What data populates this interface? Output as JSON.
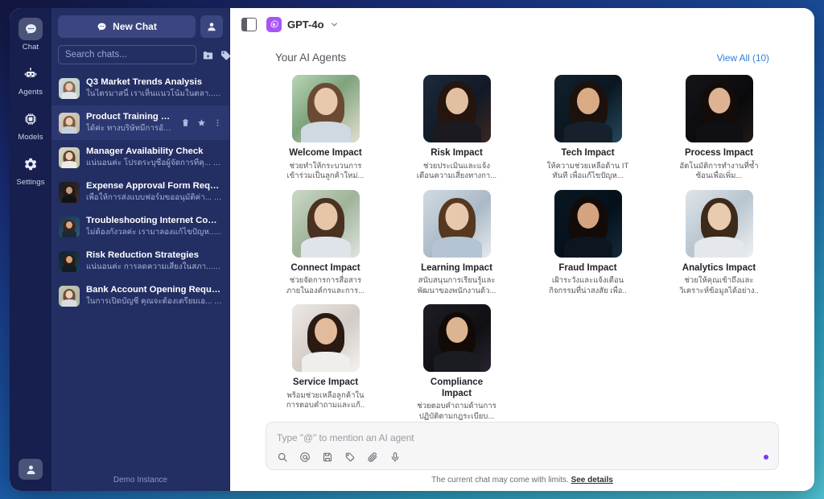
{
  "window": {
    "background_gradient": [
      "#12173f",
      "#1a2d7a",
      "#1a5aa8",
      "#2d9fc0",
      "#4fc3d4"
    ]
  },
  "rail": {
    "items": [
      {
        "label": "Chat",
        "icon": "chat-bubble-icon",
        "active": true
      },
      {
        "label": "Agents",
        "icon": "robot-icon",
        "active": false
      },
      {
        "label": "Models",
        "icon": "chip-icon",
        "active": false
      },
      {
        "label": "Settings",
        "icon": "gear-icon",
        "active": false
      }
    ],
    "bottom_icon": "user-avatar-icon"
  },
  "sidebar": {
    "new_chat_label": "New Chat",
    "new_chat_icon": "chat-bubble-icon",
    "profile_icon": "user-avatar-icon",
    "search_placeholder": "Search chats...",
    "search_value": "",
    "toolbar_icons": [
      "new-folder-icon",
      "tag-icon",
      "multi-select-icon"
    ],
    "footer_label": "Demo Instance",
    "hover_actions": [
      "delete-icon",
      "star-icon",
      "more-options-icon"
    ],
    "chats": [
      {
        "title": "Q3 Market Trends Analysis",
        "preview": "ในไตรมาสนี้ เราเห็นแนวโน้มในตลา...",
        "time": "17h",
        "hovered": false,
        "c1": "#cfd6dc",
        "c2": "#8a6a54",
        "c3": "#b8d0c2"
      },
      {
        "title": "Product Training Upda...",
        "preview": "ได้ค่ะ ทางบริษัทมีการอัป...",
        "time": "17h",
        "hovered": true,
        "c1": "#d8cfc6",
        "c2": "#7c5a42",
        "c3": "#c2b49e"
      },
      {
        "title": "Manager Availability Check",
        "preview": "แน่นอนค่ะ โปรดระบุชื่อผู้จัดการที่คุ...",
        "time": "17h",
        "hovered": false,
        "c1": "#dcd6c8",
        "c2": "#5d4433",
        "c3": "#b6bd9c"
      },
      {
        "title": "Expense Approval Form Request",
        "preview": "เพื่อให้การส่งแบบฟอร์มขออนุมัติค่า...",
        "time": "17h",
        "hovered": false,
        "c1": "#1a1a1e",
        "c2": "#2a2024",
        "c3": "#3a3036"
      },
      {
        "title": "Troubleshooting Internet Conn...",
        "preview": "ไม่ต้องกังวลค่ะ เรามาลองแก้ไขปัญห...",
        "time": "17h",
        "hovered": false,
        "c1": "#20344d",
        "c2": "#4a3228",
        "c3": "#2d5a7a"
      },
      {
        "title": "Risk Reduction Strategies",
        "preview": "แน่นอนค่ะ การลดความเสี่ยงในสภา...",
        "time": "17h",
        "hovered": false,
        "c1": "#13212e",
        "c2": "#33221c",
        "c3": "#1d4054"
      },
      {
        "title": "Bank Account Opening Require...",
        "preview": "ในการเปิดบัญชี คุณจะต้องเตรียมเอ...",
        "time": "17h",
        "hovered": false,
        "c1": "#cbc4b4",
        "c2": "#6b4d38",
        "c3": "#a8b6a0"
      }
    ]
  },
  "header": {
    "panel_toggle_icon": "panel-toggle-icon",
    "model_logo_icon": "openai-logo-icon",
    "model_name": "GPT-4o",
    "chevron_icon": "chevron-down-icon"
  },
  "agents_section": {
    "title": "Your AI Agents",
    "view_all_label": "View All (10)",
    "agents": [
      {
        "name": "Welcome Impact",
        "desc": "ช่วยทำให้กระบวนการ เข้าร่วมเป็นลูกค้าใหม่...",
        "bg": "#9dbfa0",
        "skin": "#e8c9ae",
        "hair": "#6b4a33",
        "cloth": "#cfd9e2"
      },
      {
        "name": "Risk Impact",
        "desc": "ช่วยประเมินและแจ้ง เตือนความเสี่ยงทางกา...",
        "bg": "#16202e",
        "skin": "#e3bfa2",
        "hair": "#24150f",
        "cloth": "#1a1a20"
      },
      {
        "name": "Tech Impact",
        "desc": "ให้ความช่วยเหลือด้าน IT ทันที เพื่อแก้ไขปัญห...",
        "bg": "#0e1a26",
        "skin": "#d9ab85",
        "hair": "#1c110c",
        "cloth": "#16212c"
      },
      {
        "name": "Process Impact",
        "desc": "อัตโนมัติการทำงานที่ซ้ำ ซ้อนเพื่อเพิ่ม...",
        "bg": "#0c0c0e",
        "skin": "#ddb391",
        "hair": "#140c09",
        "cloth": "#101014"
      },
      {
        "name": "Connect Impact",
        "desc": "ช่วยจัดการการสื่อสาร ภายในองค์กรและการ...",
        "bg": "#b9c8b4",
        "skin": "#e6c5a8",
        "hair": "#4a3121",
        "cloth": "#dfe4ea"
      },
      {
        "name": "Learning Impact",
        "desc": "สนับสนุนการเรียนรู้และ พัฒนาของพนักงานด้ว...",
        "bg": "#c3cdd6",
        "skin": "#e8c8ad",
        "hair": "#55381f",
        "cloth": "#b4c4d4"
      },
      {
        "name": "Fraud Impact",
        "desc": "เฝ้าระวังและแจ้งเตือน กิจกรรมที่น่าสงสัย เพื่อ..",
        "bg": "#07121c",
        "skin": "#d3a47f",
        "hair": "#130b08",
        "cloth": "#0c1620"
      },
      {
        "name": "Analytics Impact",
        "desc": "ช่วยให้คุณเข้าถึงและ วิเคราะห์ข้อมูลได้อย่าง..",
        "bg": "#cfd8de",
        "skin": "#e9cbb0",
        "hair": "#3e2a1a",
        "cloth": "#e4e8ed"
      },
      {
        "name": "Service Impact",
        "desc": "พร้อมช่วยเหลือลูกค้าใน การตอบคำถามและแก้..",
        "bg": "#e2dedb",
        "skin": "#e3bb9c",
        "hair": "#2a1a12",
        "cloth": "#f0eeec"
      },
      {
        "name": "Compliance Impact",
        "desc": "ช่วยตอบคำถามด้านการ ปฏิบัติตามกฎระเบียบ...",
        "bg": "#15151a",
        "skin": "#ddb491",
        "hair": "#110a07",
        "cloth": "#1b1b22"
      }
    ]
  },
  "composer": {
    "placeholder": "Type \"@\" to mention an AI agent",
    "value": "",
    "tool_icons": [
      "search-icon",
      "mention-icon",
      "save-icon",
      "tag-pen-icon",
      "attachment-icon",
      "microphone-icon"
    ],
    "send_indicator": "send-dot-icon",
    "send_color": "#7c3aed",
    "limits_text": "The current chat may come with limits.",
    "limits_link": "See details"
  }
}
